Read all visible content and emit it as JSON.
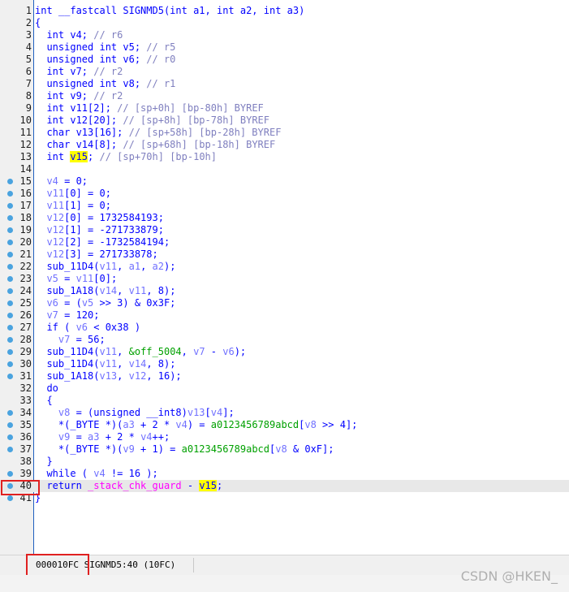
{
  "colors": {
    "keyword": "#0000ff",
    "comment": "#7f7fbf",
    "local_var": "#7070ff",
    "global": "#00a000",
    "import": "#ff00ff",
    "highlight": "#ffff00",
    "breakpoint_dot": "#4aa3df",
    "annotation_box": "#e02020"
  },
  "code": {
    "lines": [
      {
        "n": "1",
        "dot": false,
        "segs": [
          {
            "t": "int __fastcall SIGNMD5(int a1, int a2, int a3)"
          }
        ]
      },
      {
        "n": "2",
        "dot": false,
        "segs": [
          {
            "t": "{"
          }
        ]
      },
      {
        "n": "3",
        "dot": false,
        "segs": [
          {
            "t": "  int v4; "
          },
          {
            "t": "// r6",
            "c": "cmt"
          }
        ]
      },
      {
        "n": "4",
        "dot": false,
        "segs": [
          {
            "t": "  unsigned int v5; "
          },
          {
            "t": "// r5",
            "c": "cmt"
          }
        ]
      },
      {
        "n": "5",
        "dot": false,
        "segs": [
          {
            "t": "  unsigned int v6; "
          },
          {
            "t": "// r0",
            "c": "cmt"
          }
        ]
      },
      {
        "n": "6",
        "dot": false,
        "segs": [
          {
            "t": "  int v7; "
          },
          {
            "t": "// r2",
            "c": "cmt"
          }
        ]
      },
      {
        "n": "7",
        "dot": false,
        "segs": [
          {
            "t": "  unsigned int v8; "
          },
          {
            "t": "// r1",
            "c": "cmt"
          }
        ]
      },
      {
        "n": "8",
        "dot": false,
        "segs": [
          {
            "t": "  int v9; "
          },
          {
            "t": "// r2",
            "c": "cmt"
          }
        ]
      },
      {
        "n": "9",
        "dot": false,
        "segs": [
          {
            "t": "  int v11[2]; "
          },
          {
            "t": "// [sp+0h] [bp-80h] BYREF",
            "c": "cmt"
          }
        ]
      },
      {
        "n": "10",
        "dot": false,
        "segs": [
          {
            "t": "  int v12[20]; "
          },
          {
            "t": "// [sp+8h] [bp-78h] BYREF",
            "c": "cmt"
          }
        ]
      },
      {
        "n": "11",
        "dot": false,
        "segs": [
          {
            "t": "  char v13[16]; "
          },
          {
            "t": "// [sp+58h] [bp-28h] BYREF",
            "c": "cmt"
          }
        ]
      },
      {
        "n": "12",
        "dot": false,
        "segs": [
          {
            "t": "  char v14[8]; "
          },
          {
            "t": "// [sp+68h] [bp-18h] BYREF",
            "c": "cmt"
          }
        ]
      },
      {
        "n": "13",
        "dot": false,
        "segs": [
          {
            "t": "  int "
          },
          {
            "t": "v15",
            "c": "hl"
          },
          {
            "t": "; "
          },
          {
            "t": "// [sp+70h] [bp-10h]",
            "c": "cmt"
          }
        ]
      },
      {
        "n": "14",
        "dot": false,
        "segs": [
          {
            "t": ""
          }
        ]
      },
      {
        "n": "15",
        "dot": true,
        "segs": [
          {
            "t": "  "
          },
          {
            "t": "v4",
            "c": "var"
          },
          {
            "t": " = 0;"
          }
        ]
      },
      {
        "n": "16",
        "dot": true,
        "segs": [
          {
            "t": "  "
          },
          {
            "t": "v11",
            "c": "var"
          },
          {
            "t": "[0] = 0;"
          }
        ]
      },
      {
        "n": "17",
        "dot": true,
        "segs": [
          {
            "t": "  "
          },
          {
            "t": "v11",
            "c": "var"
          },
          {
            "t": "[1] = 0;"
          }
        ]
      },
      {
        "n": "18",
        "dot": true,
        "segs": [
          {
            "t": "  "
          },
          {
            "t": "v12",
            "c": "var"
          },
          {
            "t": "[0] = 1732584193;"
          }
        ]
      },
      {
        "n": "19",
        "dot": true,
        "segs": [
          {
            "t": "  "
          },
          {
            "t": "v12",
            "c": "var"
          },
          {
            "t": "[1] = -271733879;"
          }
        ]
      },
      {
        "n": "20",
        "dot": true,
        "segs": [
          {
            "t": "  "
          },
          {
            "t": "v12",
            "c": "var"
          },
          {
            "t": "[2] = -1732584194;"
          }
        ]
      },
      {
        "n": "21",
        "dot": true,
        "segs": [
          {
            "t": "  "
          },
          {
            "t": "v12",
            "c": "var"
          },
          {
            "t": "[3] = 271733878;"
          }
        ]
      },
      {
        "n": "22",
        "dot": true,
        "segs": [
          {
            "t": "  sub_11D4("
          },
          {
            "t": "v11",
            "c": "var"
          },
          {
            "t": ", "
          },
          {
            "t": "a1",
            "c": "var"
          },
          {
            "t": ", "
          },
          {
            "t": "a2",
            "c": "var"
          },
          {
            "t": ");"
          }
        ]
      },
      {
        "n": "23",
        "dot": true,
        "segs": [
          {
            "t": "  "
          },
          {
            "t": "v5",
            "c": "var"
          },
          {
            "t": " = "
          },
          {
            "t": "v11",
            "c": "var"
          },
          {
            "t": "[0];"
          }
        ]
      },
      {
        "n": "24",
        "dot": true,
        "segs": [
          {
            "t": "  sub_1A18("
          },
          {
            "t": "v14",
            "c": "var"
          },
          {
            "t": ", "
          },
          {
            "t": "v11",
            "c": "var"
          },
          {
            "t": ", 8);"
          }
        ]
      },
      {
        "n": "25",
        "dot": true,
        "segs": [
          {
            "t": "  "
          },
          {
            "t": "v6",
            "c": "var"
          },
          {
            "t": " = ("
          },
          {
            "t": "v5",
            "c": "var"
          },
          {
            "t": " >> 3) & 0x3F;"
          }
        ]
      },
      {
        "n": "26",
        "dot": true,
        "segs": [
          {
            "t": "  "
          },
          {
            "t": "v7",
            "c": "var"
          },
          {
            "t": " = 120;"
          }
        ]
      },
      {
        "n": "27",
        "dot": true,
        "segs": [
          {
            "t": "  if ( "
          },
          {
            "t": "v6",
            "c": "var"
          },
          {
            "t": " < 0x38 )"
          }
        ]
      },
      {
        "n": "28",
        "dot": true,
        "segs": [
          {
            "t": "    "
          },
          {
            "t": "v7",
            "c": "var"
          },
          {
            "t": " = 56;"
          }
        ]
      },
      {
        "n": "29",
        "dot": true,
        "segs": [
          {
            "t": "  sub_11D4("
          },
          {
            "t": "v11",
            "c": "var"
          },
          {
            "t": ", "
          },
          {
            "t": "&off_5004",
            "c": "grn"
          },
          {
            "t": ", "
          },
          {
            "t": "v7",
            "c": "var"
          },
          {
            "t": " - "
          },
          {
            "t": "v6",
            "c": "var"
          },
          {
            "t": ");"
          }
        ]
      },
      {
        "n": "30",
        "dot": true,
        "segs": [
          {
            "t": "  sub_11D4("
          },
          {
            "t": "v11",
            "c": "var"
          },
          {
            "t": ", "
          },
          {
            "t": "v14",
            "c": "var"
          },
          {
            "t": ", 8);"
          }
        ]
      },
      {
        "n": "31",
        "dot": true,
        "segs": [
          {
            "t": "  sub_1A18("
          },
          {
            "t": "v13",
            "c": "var"
          },
          {
            "t": ", "
          },
          {
            "t": "v12",
            "c": "var"
          },
          {
            "t": ", 16);"
          }
        ]
      },
      {
        "n": "32",
        "dot": false,
        "segs": [
          {
            "t": "  do"
          }
        ]
      },
      {
        "n": "33",
        "dot": false,
        "segs": [
          {
            "t": "  {"
          }
        ]
      },
      {
        "n": "34",
        "dot": true,
        "segs": [
          {
            "t": "    "
          },
          {
            "t": "v8",
            "c": "var"
          },
          {
            "t": " = (unsigned __int8)"
          },
          {
            "t": "v13",
            "c": "var"
          },
          {
            "t": "["
          },
          {
            "t": "v4",
            "c": "var"
          },
          {
            "t": "];"
          }
        ]
      },
      {
        "n": "35",
        "dot": true,
        "segs": [
          {
            "t": "    *(_BYTE *)("
          },
          {
            "t": "a3",
            "c": "var"
          },
          {
            "t": " + 2 * "
          },
          {
            "t": "v4",
            "c": "var"
          },
          {
            "t": ") = "
          },
          {
            "t": "a0123456789abcd",
            "c": "grn"
          },
          {
            "t": "["
          },
          {
            "t": "v8",
            "c": "var"
          },
          {
            "t": " >> 4];"
          }
        ]
      },
      {
        "n": "36",
        "dot": true,
        "segs": [
          {
            "t": "    "
          },
          {
            "t": "v9",
            "c": "var"
          },
          {
            "t": " = "
          },
          {
            "t": "a3",
            "c": "var"
          },
          {
            "t": " + 2 * "
          },
          {
            "t": "v4",
            "c": "var"
          },
          {
            "t": "++;"
          }
        ]
      },
      {
        "n": "37",
        "dot": true,
        "segs": [
          {
            "t": "    *(_BYTE *)("
          },
          {
            "t": "v9",
            "c": "var"
          },
          {
            "t": " + 1) = "
          },
          {
            "t": "a0123456789abcd",
            "c": "grn"
          },
          {
            "t": "["
          },
          {
            "t": "v8",
            "c": "var"
          },
          {
            "t": " & 0xF];"
          }
        ]
      },
      {
        "n": "38",
        "dot": false,
        "segs": [
          {
            "t": "  }"
          }
        ]
      },
      {
        "n": "39",
        "dot": true,
        "segs": [
          {
            "t": "  while ( "
          },
          {
            "t": "v4",
            "c": "var"
          },
          {
            "t": " != 16 );"
          }
        ]
      },
      {
        "n": "40",
        "dot": true,
        "current": true,
        "segs": [
          {
            "t": "  return "
          },
          {
            "t": "_stack_chk_guard",
            "c": "pink"
          },
          {
            "t": " - "
          },
          {
            "t": "v15",
            "c": "hl"
          },
          {
            "t": ";"
          }
        ]
      },
      {
        "n": "41",
        "dot": true,
        "segs": [
          {
            "t": "}"
          }
        ]
      }
    ]
  },
  "status": {
    "address": "000010FC",
    "location": "SIGNMD5:40 (10FC)"
  },
  "watermark": "CSDN @HKEN_"
}
